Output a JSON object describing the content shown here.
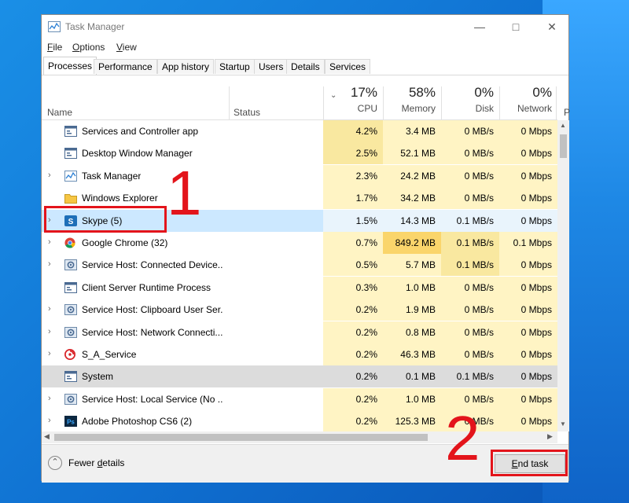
{
  "window": {
    "title": "Task Manager"
  },
  "menu": [
    {
      "label": "File",
      "mnemonic": "F",
      "rest": "ile"
    },
    {
      "label": "Options",
      "mnemonic": "O",
      "rest": "ptions"
    },
    {
      "label": "View",
      "mnemonic": "V",
      "rest": "iew"
    }
  ],
  "tabs": [
    "Processes",
    "Performance",
    "App history",
    "Startup",
    "Users",
    "Details",
    "Services"
  ],
  "active_tab": "Processes",
  "columns": {
    "name": "Name",
    "status": "Status",
    "cpu": {
      "pct": "17%",
      "label": "CPU"
    },
    "memory": {
      "pct": "58%",
      "label": "Memory"
    },
    "disk": {
      "pct": "0%",
      "label": "Disk"
    },
    "network": {
      "pct": "0%",
      "label": "Network"
    },
    "extra_label": "P"
  },
  "processes": [
    {
      "name": "Services and Controller app",
      "expand": false,
      "icon": "app-window-icon",
      "cpu": "4.2%",
      "mem": "3.4 MB",
      "disk": "0 MB/s",
      "net": "0 Mbps"
    },
    {
      "name": "Desktop Window Manager",
      "expand": false,
      "icon": "app-window-icon",
      "cpu": "2.5%",
      "mem": "52.1 MB",
      "disk": "0 MB/s",
      "net": "0 Mbps"
    },
    {
      "name": "Task Manager",
      "expand": true,
      "icon": "task-manager-icon",
      "cpu": "2.3%",
      "mem": "24.2 MB",
      "disk": "0 MB/s",
      "net": "0 Mbps"
    },
    {
      "name": "Windows Explorer",
      "expand": false,
      "icon": "folder-icon",
      "cpu": "1.7%",
      "mem": "34.2 MB",
      "disk": "0 MB/s",
      "net": "0 Mbps"
    },
    {
      "name": "Skype (5)",
      "expand": true,
      "icon": "skype-icon",
      "cpu": "1.5%",
      "mem": "14.3 MB",
      "disk": "0.1 MB/s",
      "net": "0 Mbps",
      "selected": true
    },
    {
      "name": "Google Chrome (32)",
      "expand": true,
      "icon": "chrome-icon",
      "cpu": "0.7%",
      "mem": "849.2 MB",
      "disk": "0.1 MB/s",
      "net": "0.1 Mbps",
      "mem_hot": true
    },
    {
      "name": "Service Host: Connected Device...",
      "expand": true,
      "icon": "gear-icon",
      "cpu": "0.5%",
      "mem": "5.7 MB",
      "disk": "0.1 MB/s",
      "net": "0 Mbps"
    },
    {
      "name": "Client Server Runtime Process",
      "expand": false,
      "icon": "app-window-icon",
      "cpu": "0.3%",
      "mem": "1.0 MB",
      "disk": "0 MB/s",
      "net": "0 Mbps"
    },
    {
      "name": "Service Host: Clipboard User Ser...",
      "expand": true,
      "icon": "gear-icon",
      "cpu": "0.2%",
      "mem": "1.9 MB",
      "disk": "0 MB/s",
      "net": "0 Mbps"
    },
    {
      "name": "Service Host: Network Connecti...",
      "expand": true,
      "icon": "gear-icon",
      "cpu": "0.2%",
      "mem": "0.8 MB",
      "disk": "0 MB/s",
      "net": "0 Mbps"
    },
    {
      "name": "S_A_Service",
      "expand": true,
      "icon": "swirl-icon",
      "cpu": "0.2%",
      "mem": "46.3 MB",
      "disk": "0 MB/s",
      "net": "0 Mbps"
    },
    {
      "name": "System",
      "expand": false,
      "icon": "app-window-icon",
      "cpu": "0.2%",
      "mem": "0.1 MB",
      "disk": "0.1 MB/s",
      "net": "0 Mbps",
      "hover": true
    },
    {
      "name": "Service Host: Local Service (No ...",
      "expand": true,
      "icon": "gear-icon",
      "cpu": "0.2%",
      "mem": "1.0 MB",
      "disk": "0 MB/s",
      "net": "0 Mbps"
    },
    {
      "name": "Adobe Photoshop CS6 (2)",
      "expand": true,
      "icon": "photoshop-icon",
      "cpu": "0.2%",
      "mem": "125.3 MB",
      "disk": "0 MB/s",
      "net": "0 Mbps"
    }
  ],
  "footer": {
    "fewer_details_pre": "Fewer ",
    "fewer_details_mn": "d",
    "fewer_details_post": "etails",
    "end_task_pre": "",
    "end_task_mn": "E",
    "end_task_post": "nd task"
  },
  "annotations": {
    "one": "1",
    "two": "2"
  },
  "colors": {
    "heat_light": "#fff4c4",
    "heat_mid": "#f9e8a0",
    "heat_hot": "#fad56b",
    "selected": "#cce8ff",
    "annotation": "#e3141b"
  }
}
